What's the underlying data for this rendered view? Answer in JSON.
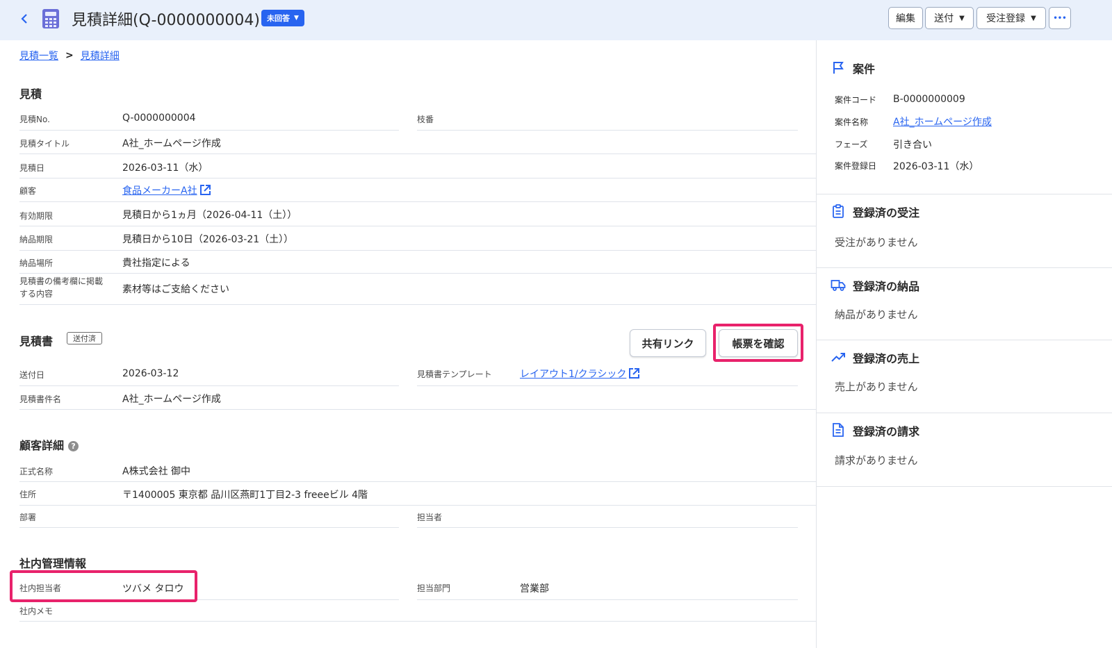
{
  "header": {
    "title": "見積詳細(Q-0000000004)",
    "status": "未回答",
    "buttons": {
      "edit": "編集",
      "send": "送付",
      "order": "受注登録",
      "more": "•••"
    }
  },
  "breadcrumb": {
    "list": "見積一覧",
    "current": "見積詳細"
  },
  "estimate": {
    "title": "見積",
    "fields": {
      "no_label": "見積No.",
      "no_value": "Q-0000000004",
      "branch_label": "枝番",
      "branch_value": "",
      "title_label": "見積タイトル",
      "title_value": "A社_ホームページ作成",
      "date_label": "見積日",
      "date_value": "2026-03-11（水）",
      "customer_label": "顧客",
      "customer_value": "食品メーカーA社",
      "valid_label": "有効期限",
      "valid_value": "見積日から1ヵ月（2026-04-11（土））",
      "delivery_label": "納品期限",
      "delivery_value": "見積日から10日（2026-03-21（土））",
      "place_label": "納品場所",
      "place_value": "貴社指定による",
      "remarks_label_1": "見積書の備考欄に掲載",
      "remarks_label_2": "する内容",
      "remarks_value": "素材等はご支給ください"
    }
  },
  "document": {
    "title": "見積書",
    "badge": "送付済",
    "share_link_label": "共有リンク",
    "confirm_label": "帳票を確認",
    "sent_label": "送付日",
    "sent_value": "2026-03-12",
    "template_label": "見積書テンプレート",
    "template_value": "レイアウト1/クラシック",
    "name_label": "見積書件名",
    "name_value": "A社_ホームページ作成"
  },
  "customer_detail": {
    "title": "顧客詳細",
    "help": "?",
    "official_label": "正式名称",
    "official_value": "A株式会社 御中",
    "address_label": "住所",
    "address_value": "〒1400005 東京都 品川区燕町1丁目2-3 freeeビル 4階",
    "dept_label": "部署",
    "dept_value": "",
    "person_label": "担当者",
    "person_value": ""
  },
  "internal": {
    "title": "社内管理情報",
    "owner_label": "社内担当者",
    "owner_value": "ツバメ タロウ",
    "dept_label": "担当部門",
    "dept_value": "営業部",
    "memo_label": "社内メモ",
    "memo_value": ""
  },
  "sidebar": {
    "deal": {
      "title": "案件",
      "code_label": "案件コード",
      "code_value": "B-0000000009",
      "name_label": "案件名称",
      "name_value": "A社_ホームページ作成",
      "phase_label": "フェーズ",
      "phase_value": "引き合い",
      "date_label": "案件登録日",
      "date_value": "2026-03-11（水）"
    },
    "orders": {
      "title": "登録済の受注",
      "empty": "受注がありません"
    },
    "deliveries": {
      "title": "登録済の納品",
      "empty": "納品がありません"
    },
    "sales": {
      "title": "登録済の売上",
      "empty": "売上がありません"
    },
    "invoices": {
      "title": "登録済の請求",
      "empty": "請求がありません"
    }
  },
  "colors": {
    "accent": "#2864f0",
    "highlight": "#e8226b",
    "header_bg": "#e9f0fb"
  }
}
